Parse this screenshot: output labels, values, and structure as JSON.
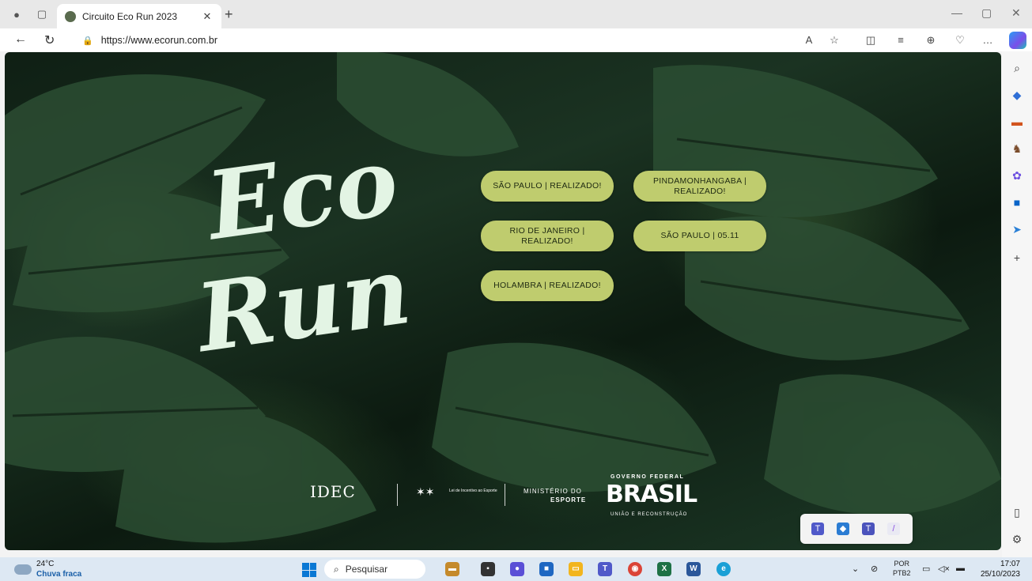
{
  "browser": {
    "tab_title": "Circuito Eco Run 2023",
    "tab_close": "✕",
    "new_tab": "+",
    "url": "https://www.ecorun.com.br",
    "url_lock": "🔒"
  },
  "page": {
    "logo_line1": "Eco",
    "logo_line2": "Run",
    "events": [
      {
        "label": "SÃO PAULO | REALIZADO!"
      },
      {
        "label": "PINDAMONHANGABA | REALIZADO!"
      },
      {
        "label": "RIO DE JANEIRO | REALIZADO!"
      },
      {
        "label": "SÃO PAULO | 05.11"
      },
      {
        "label": "HOLAMBRA | REALIZADO!"
      }
    ],
    "sponsors": {
      "idec": "IDEC",
      "lei": "Lei de Incentivo ao Esporte",
      "ministerio_1": "MINISTÉRIO DO",
      "ministerio_2": "ESPORTE",
      "gov": "GOVERNO FEDERAL",
      "brasil": "BRASIL",
      "uniao": "UNIÃO E RECONSTRUÇÃO"
    },
    "accent_color": "#bfcc6e"
  },
  "taskbar": {
    "temperature": "24°C",
    "weather": "Chuva fraca",
    "search_placeholder": "Pesquisar",
    "lang_1": "POR",
    "lang_2": "PTB2",
    "time": "17:07",
    "date": "25/10/2023"
  }
}
